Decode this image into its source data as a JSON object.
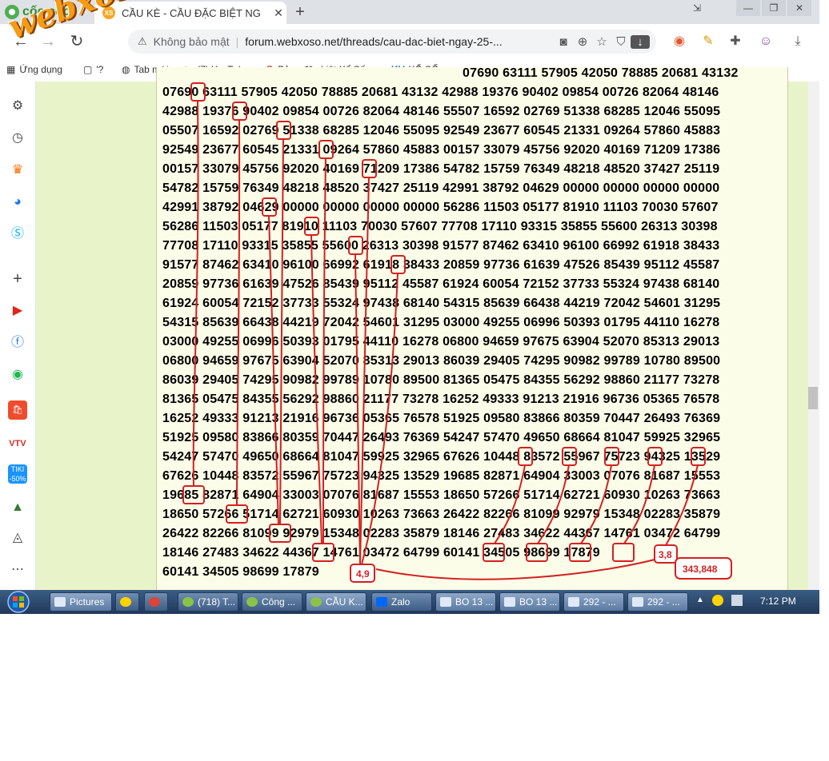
{
  "browser": {
    "brand": "cốc cốc",
    "tab_title": "CẦU KÈ - CẦU ĐẶC BIỆT NG",
    "tab_badge": "XS",
    "new_tab": "+",
    "window_buttons": [
      "⇲",
      "—",
      "❐",
      "✕"
    ],
    "security_label": "Không bảo mật",
    "url": "forum.webxoso.net/threads/cau-dac-biet-ngay-25-...",
    "bookmarks": [
      "Ứng dụng",
      "'?",
      "Tab mới",
      "(7) YouTube",
      "Bảng đặc biệt Xổ Số...",
      "XỔ SỐ"
    ]
  },
  "watermark": "webxoso.net",
  "post": {
    "first_line": "07690 63111 57905 42050 78885 20681 43132",
    "lines": [
      "07690 63111 57905 42050 78885 20681 43132 42988 19376 90402 09854 00726 82064 48146",
      "42988 19376 90402 09854 00726 82064 48146 55507 16592 02769 51338 68285 12046 55095",
      "05507 16592 02769 51338 68285 12046 55095 92549 23677 60545 21331 09264 57860 45883",
      "92549 23677 60545 21331 09264 57860 45883 00157 33079 45756 92020 40169 71209 17386",
      "00157 33079 45756 92020 40169 71209 17386 54782 15759 76349 48218 48520 37427 25119",
      "54782 15759 76349 48218 48520 37427 25119 42991 38792 04629 00000 00000 00000 00000",
      "42991 38792 04629 00000 00000 00000 00000 56286 11503 05177 81910 11103 70030 57607",
      "56286 11503 05177 81910 11103 70030 57607 77708 17110 93315 35855 55600 26313 30398",
      "77708 17110 93315 35855 55600 26313 30398 91577 87462 63410 96100 66992 61918 38433",
      "91577 87462 63410 96100 66992 61918 38433 20859 97736 61639 47526 85439 95112 45587",
      "20859 97736 61639 47526 85439 95112 45587 61924 60054 72152 37733 55324 97438 68140",
      "61924 60054 72152 37733 55324 97438 68140 54315 85639 66438 44219 72042 54601 31295",
      "54315 85639 66438 44219 72042 54601 31295 03000 49255 06996 50393 01795 44110 16278",
      "03000 49255 06996 50393 01795 44110 16278 06800 94659 97675 63904 52070 85313 29013",
      "06800 94659 97675 63904 52070 85313 29013 86039 29405 74295 90982 99789 10780 89500",
      "86039 29405 74295 90982 99789 10780 89500 81365 05475 84355 56292 98860 21177 73278",
      "81365 05475 84355 56292 98860 21177 73278 16252 49333 91213 21916 96736 05365 76578",
      "16252 49333 91213 21916 96736 05365 76578 51925 09580 83866 80359 70447 26493 76369",
      "51925 09580 83866 80359 70447 26493 76369 54247 57470 49650 68664 81047 59925 32965",
      "54247 57470 49650 68664 81047 59925 32965 67626 10448 83572 55967 75723 94325 13529",
      "67626 10448 83572 55967 75723 94325 13529 19685 82871 64904 33003 07076 81687 15553",
      "19685 82871 64904 33003 07076 81687 15553 18650 57266 51714 62721 60930 10263 73663",
      "18650 57266 51714 62721 60930 10263 73663 26422 82266 81099 92979 15348 02283 35879",
      "26422 82266 81099 92979 15348 02283 35879 18146 27483 34622 44367 14761 03472 64799",
      "18146 27483 34622 44367 14761 03472 64799 60141 34505 98699 17879",
      "60141 34505 98699 17879"
    ],
    "annotations": {
      "left_result": "4,9",
      "right_result": "3,8",
      "bottom_result": "343,848"
    }
  },
  "taskbar": {
    "items": [
      "Pictures",
      "",
      "",
      "(718) T...",
      "Công ...",
      "CẦU K...",
      "Zalo",
      "BO 13 ...",
      "BO 13 ...",
      "292 - ...",
      "292 - ..."
    ],
    "clock": "7:12 PM"
  }
}
